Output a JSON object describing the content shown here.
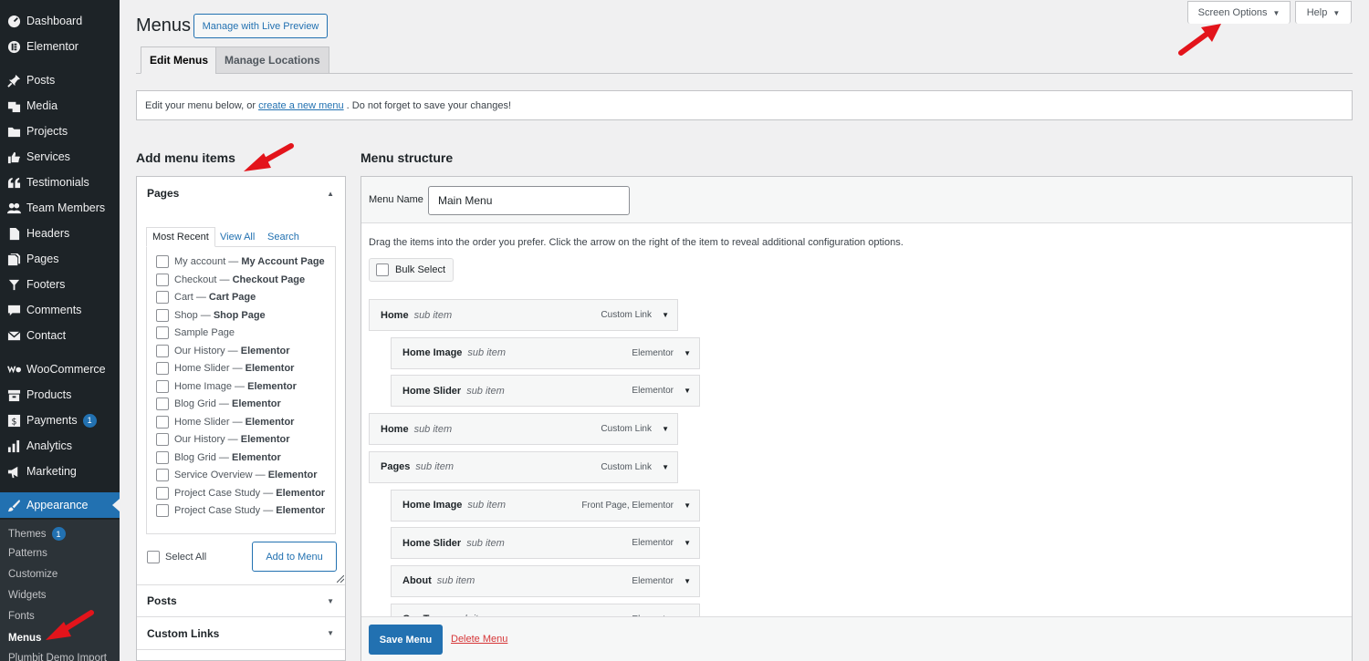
{
  "sidebar": {
    "items": [
      {
        "label": "Dashboard",
        "icon": "dashboard-icon"
      },
      {
        "label": "Elementor",
        "icon": "elementor-icon"
      },
      {
        "label": "Posts",
        "icon": "pin-icon"
      },
      {
        "label": "Media",
        "icon": "media-icon"
      },
      {
        "label": "Projects",
        "icon": "folder-icon"
      },
      {
        "label": "Services",
        "icon": "thumbs-up-icon"
      },
      {
        "label": "Testimonials",
        "icon": "quote-icon"
      },
      {
        "label": "Team Members",
        "icon": "users-icon"
      },
      {
        "label": "Headers",
        "icon": "document-icon"
      },
      {
        "label": "Pages",
        "icon": "pages-icon"
      },
      {
        "label": "Footers",
        "icon": "filter-icon"
      },
      {
        "label": "Comments",
        "icon": "comment-icon"
      },
      {
        "label": "Contact",
        "icon": "mail-icon"
      },
      {
        "label": "WooCommerce",
        "icon": "woocommerce-icon"
      },
      {
        "label": "Products",
        "icon": "archive-icon"
      },
      {
        "label": "Payments",
        "icon": "dollar-icon",
        "badge": "1"
      },
      {
        "label": "Analytics",
        "icon": "bar-chart-icon"
      },
      {
        "label": "Marketing",
        "icon": "megaphone-icon"
      },
      {
        "label": "Appearance",
        "icon": "brush-icon"
      }
    ],
    "submenu": [
      {
        "label": "Themes",
        "badge": "1"
      },
      {
        "label": "Patterns"
      },
      {
        "label": "Customize"
      },
      {
        "label": "Widgets"
      },
      {
        "label": "Fonts"
      },
      {
        "label": "Menus"
      },
      {
        "label": "Plumbit Demo Import"
      }
    ]
  },
  "header": {
    "title": "Menus",
    "live_preview": "Manage with Live Preview",
    "screen_options": "Screen Options",
    "help": "Help"
  },
  "tabs": {
    "edit": "Edit Menus",
    "locations": "Manage Locations"
  },
  "notice": {
    "before": "Edit your menu below, or",
    "link": "create a new menu",
    "after": ". Do not forget to save your changes!"
  },
  "add_items": {
    "title": "Add menu items",
    "pages_heading": "Pages",
    "subtabs": [
      "Most Recent",
      "View All",
      "Search"
    ],
    "pages": [
      {
        "name": "My account",
        "tag": "My Account Page"
      },
      {
        "name": "Checkout",
        "tag": "Checkout Page"
      },
      {
        "name": "Cart",
        "tag": "Cart Page"
      },
      {
        "name": "Shop",
        "tag": "Shop Page"
      },
      {
        "name": "Sample Page",
        "tag": ""
      },
      {
        "name": "Our History",
        "tag": "Elementor"
      },
      {
        "name": "Home Slider",
        "tag": "Elementor"
      },
      {
        "name": "Home Image",
        "tag": "Elementor"
      },
      {
        "name": "Blog Grid",
        "tag": "Elementor"
      },
      {
        "name": "Home Slider",
        "tag": "Elementor"
      },
      {
        "name": "Our History",
        "tag": "Elementor"
      },
      {
        "name": "Blog Grid",
        "tag": "Elementor"
      },
      {
        "name": "Service Overview",
        "tag": "Elementor"
      },
      {
        "name": "Project Case Study",
        "tag": "Elementor"
      },
      {
        "name": "Project Case Study",
        "tag": "Elementor"
      }
    ],
    "separator": " — ",
    "select_all": "Select All",
    "add_button": "Add to Menu",
    "posts_heading": "Posts",
    "custom_links_heading": "Custom Links"
  },
  "structure": {
    "title": "Menu structure",
    "menu_name_label": "Menu Name",
    "menu_name_value": "Main Menu",
    "hint": "Drag the items into the order you prefer. Click the arrow on the right of the item to reveal additional configuration options.",
    "bulk_select": "Bulk Select",
    "items": [
      {
        "title": "Home",
        "sub": "sub item",
        "type": "Custom Link",
        "depth": 0
      },
      {
        "title": "Home Image",
        "sub": "sub item",
        "type": "Elementor",
        "depth": 1
      },
      {
        "title": "Home Slider",
        "sub": "sub item",
        "type": "Elementor",
        "depth": 1
      },
      {
        "title": "Home",
        "sub": "sub item",
        "type": "Custom Link",
        "depth": 0
      },
      {
        "title": "Pages",
        "sub": "sub item",
        "type": "Custom Link",
        "depth": 0
      },
      {
        "title": "Home Image",
        "sub": "sub item",
        "type": "Front Page, Elementor",
        "depth": 1
      },
      {
        "title": "Home Slider",
        "sub": "sub item",
        "type": "Elementor",
        "depth": 1
      },
      {
        "title": "About",
        "sub": "sub item",
        "type": "Elementor",
        "depth": 1
      },
      {
        "title": "Our Team",
        "sub": "sub item",
        "type": "Elementor",
        "depth": 1
      }
    ],
    "save": "Save Menu",
    "delete": "Delete Menu"
  },
  "colors": {
    "accent": "#2271b1",
    "sidebar_bg": "#1d2327",
    "annotation_arrow": "#e3141b",
    "delete": "#d63638"
  }
}
